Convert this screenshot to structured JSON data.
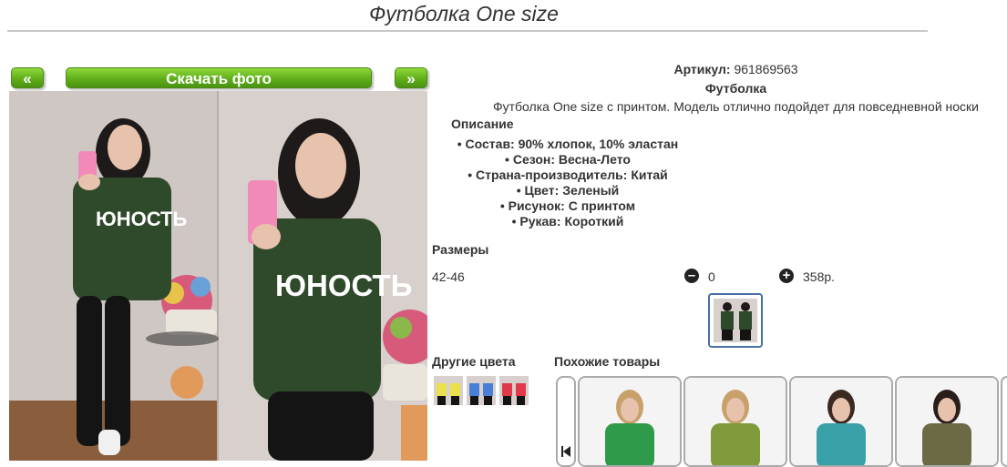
{
  "page": {
    "title": "Футболка One size"
  },
  "gallery": {
    "prev_label": "«",
    "download_label": "Скачать фото",
    "next_label": "»"
  },
  "product": {
    "article_label": "Артикул:",
    "article_value": "961869563",
    "name": "Футболка",
    "summary": "Футболка One size с принтом. Модель отлично подойдет для повседневной носки",
    "description_heading": "Описание",
    "specs": [
      "Состав: 90% хлопок, 10% эластан",
      "Сезон: Весна-Лето",
      "Страна-производитель: Китай",
      "Цвет: Зеленый",
      "Рисунок: С принтом",
      "Рукав: Короткий"
    ]
  },
  "sizes": {
    "heading": "Размеры",
    "rows": [
      {
        "size": "42-46",
        "quantity": "0",
        "price": "358р."
      }
    ]
  },
  "other_colors": {
    "heading": "Другие цвета",
    "thumb_colors": [
      "#e9e04a",
      "#4a7fd8",
      "#e03a4a"
    ]
  },
  "similar": {
    "heading": "Похожие товары",
    "shirt_colors": [
      "#2f9a4a",
      "#7f9a3a",
      "#3aa0a8",
      "#6b6a45"
    ]
  },
  "colors": {
    "accent_green": "#5fae1a",
    "shirt_green": "#2f4a2a",
    "selected_border": "#4a6fa5"
  },
  "icons": {
    "minus": "minus-circle-icon",
    "plus": "plus-circle-icon",
    "first": "first-page-icon"
  }
}
